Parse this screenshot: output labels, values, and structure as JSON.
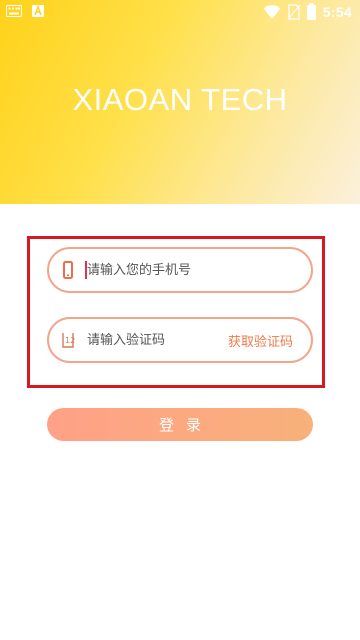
{
  "status_bar": {
    "time": "5:54",
    "battery_level": "battery-full",
    "icons": [
      "keyboard-icon",
      "app-notification-icon",
      "wifi-icon",
      "no-sim-icon",
      "battery-icon"
    ]
  },
  "header": {
    "brand_title": "XIAOAN TECH",
    "gradient_colors": [
      "#ffd21a",
      "#fbf0dc"
    ]
  },
  "login_form": {
    "phone_input": {
      "placeholder": "请输入您的手机号",
      "value": "",
      "icon": "phone-icon"
    },
    "code_input": {
      "placeholder": "请输入验证码",
      "value": "",
      "icon": "verification-code-icon"
    },
    "get_code_label": "获取验证码",
    "login_label": "登录"
  },
  "colors": {
    "accent": "#f07a4a",
    "field_border": "#f2a58b",
    "highlight_box": "#d8171f",
    "button_gradient": [
      "#ffa187",
      "#f8b17a"
    ]
  }
}
